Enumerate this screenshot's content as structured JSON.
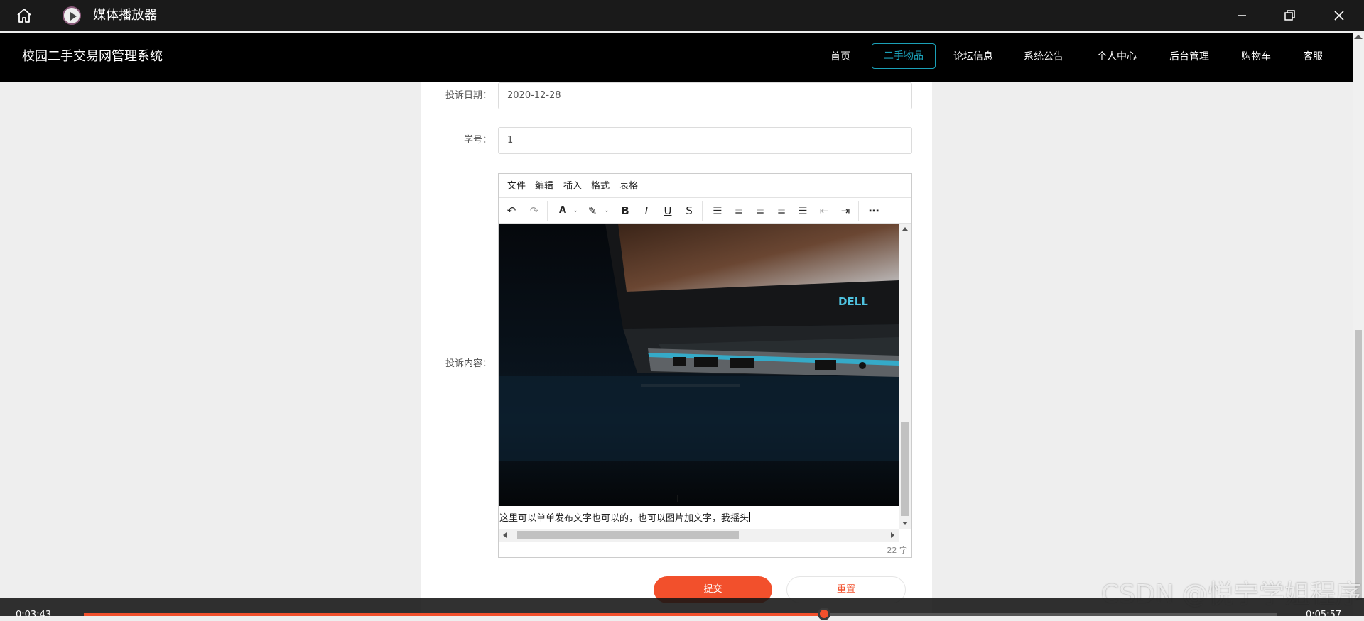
{
  "player": {
    "title": "媒体播放器",
    "current_time": "0:03:43",
    "total_time": "0:05:57",
    "progress": 0.62
  },
  "site": {
    "title": "校园二手交易网管理系统",
    "nav": [
      "首页",
      "二手物品",
      "论坛信息",
      "系统公告",
      "个人中心",
      "后台管理",
      "购物车",
      "客服"
    ],
    "active_nav": "二手物品"
  },
  "form": {
    "date_label": "投诉日期：",
    "date_value": "2020-12-28",
    "student_id_label": "学号：",
    "student_id_value": "1",
    "content_label": "投诉内容："
  },
  "editor": {
    "menus": [
      "文件",
      "编辑",
      "插入",
      "格式",
      "表格"
    ],
    "text": "这里可以单单发布文字也可以的，也可以图片加文字，我摇头",
    "word_count": "22 字",
    "image_brand": "DELL"
  },
  "buttons": {
    "submit": "提交",
    "reset": "重置"
  },
  "watermark": "CSDN @悦宁学姐程序"
}
